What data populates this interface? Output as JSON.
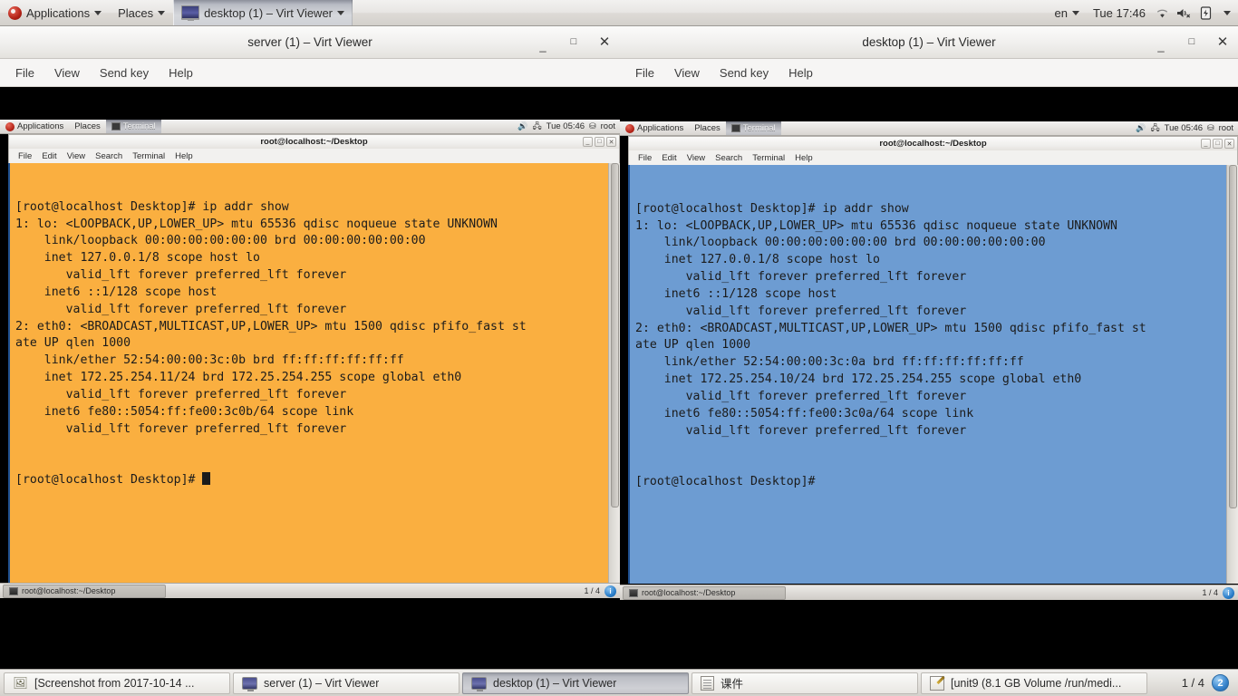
{
  "top_panel": {
    "applications": "Applications",
    "places": "Places",
    "active_window": "desktop (1) – Virt Viewer",
    "language": "en",
    "clock": "Tue 17:46",
    "icons": [
      "fedora-logo-icon",
      "chevron-down-icon",
      "wifi-icon",
      "volume-muted-icon",
      "battery-icon"
    ]
  },
  "windows": [
    {
      "title": "server (1) – Virt Viewer",
      "menu": [
        "File",
        "View",
        "Send key",
        "Help"
      ],
      "controls": {
        "minimize": "_",
        "maximize": "□",
        "close": "✕"
      },
      "guest": {
        "panel": {
          "applications": "Applications",
          "places": "Places",
          "active_app": "Terminal",
          "clock": "Tue 05:46",
          "user": "root"
        },
        "terminal": {
          "title": "root@localhost:~/Desktop",
          "menu": [
            "File",
            "Edit",
            "View",
            "Search",
            "Terminal",
            "Help"
          ],
          "theme": "orange",
          "bg": "#faaf40",
          "lines": [
            "[root@localhost Desktop]# ip addr show",
            "1: lo: <LOOPBACK,UP,LOWER_UP> mtu 65536 qdisc noqueue state UNKNOWN",
            "    link/loopback 00:00:00:00:00:00 brd 00:00:00:00:00:00",
            "    inet 127.0.0.1/8 scope host lo",
            "       valid_lft forever preferred_lft forever",
            "    inet6 ::1/128 scope host",
            "       valid_lft forever preferred_lft forever",
            "2: eth0: <BROADCAST,MULTICAST,UP,LOWER_UP> mtu 1500 qdisc pfifo_fast st",
            "ate UP qlen 1000",
            "    link/ether 52:54:00:00:3c:0b brd ff:ff:ff:ff:ff:ff",
            "    inet 172.25.254.11/24 brd 172.25.254.255 scope global eth0",
            "       valid_lft forever preferred_lft forever",
            "    inet6 fe80::5054:ff:fe00:3c0b/64 scope link",
            "       valid_lft forever preferred_lft forever"
          ],
          "prompt": "[root@localhost Desktop]# ",
          "has_cursor": true
        },
        "taskbar": {
          "task_label": "root@localhost:~/Desktop",
          "workspace": "1 / 4",
          "badge": "i"
        }
      }
    },
    {
      "title": "desktop (1) – Virt Viewer",
      "menu": [
        "File",
        "View",
        "Send key",
        "Help"
      ],
      "controls": {
        "minimize": "_",
        "maximize": "□",
        "close": "✕"
      },
      "guest": {
        "panel": {
          "applications": "Applications",
          "places": "Places",
          "active_app": "Terminal",
          "clock": "Tue 05:46",
          "user": "root"
        },
        "terminal": {
          "title": "root@localhost:~/Desktop",
          "menu": [
            "File",
            "Edit",
            "View",
            "Search",
            "Terminal",
            "Help"
          ],
          "theme": "blue",
          "bg": "#6d9cd2",
          "lines": [
            "[root@localhost Desktop]# ip addr show",
            "1: lo: <LOOPBACK,UP,LOWER_UP> mtu 65536 qdisc noqueue state UNKNOWN",
            "    link/loopback 00:00:00:00:00:00 brd 00:00:00:00:00:00",
            "    inet 127.0.0.1/8 scope host lo",
            "       valid_lft forever preferred_lft forever",
            "    inet6 ::1/128 scope host",
            "       valid_lft forever preferred_lft forever",
            "2: eth0: <BROADCAST,MULTICAST,UP,LOWER_UP> mtu 1500 qdisc pfifo_fast st",
            "ate UP qlen 1000",
            "    link/ether 52:54:00:00:3c:0a brd ff:ff:ff:ff:ff:ff",
            "    inet 172.25.254.10/24 brd 172.25.254.255 scope global eth0",
            "       valid_lft forever preferred_lft forever",
            "    inet6 fe80::5054:ff:fe00:3c0a/64 scope link",
            "       valid_lft forever preferred_lft forever"
          ],
          "prompt": "[root@localhost Desktop]#",
          "has_cursor": false
        },
        "taskbar": {
          "task_label": "root@localhost:~/Desktop",
          "workspace": "1 / 4",
          "badge": "i"
        }
      }
    }
  ],
  "host_taskbar": {
    "tasks": [
      {
        "label": "[Screenshot from 2017-10-14 ...",
        "icon": "screenshot-icon",
        "selected": false
      },
      {
        "label": "server (1) – Virt Viewer",
        "icon": "monitor-icon",
        "selected": false
      },
      {
        "label": "desktop (1) – Virt Viewer",
        "icon": "monitor-icon",
        "selected": true
      },
      {
        "label": "课件",
        "icon": "folder-doc-icon",
        "selected": false
      },
      {
        "label": "[unit9 (8.1 GB Volume /run/medi...",
        "icon": "pencil-doc-icon",
        "selected": false
      }
    ],
    "workspace": "1 / 4",
    "badge": "2"
  }
}
